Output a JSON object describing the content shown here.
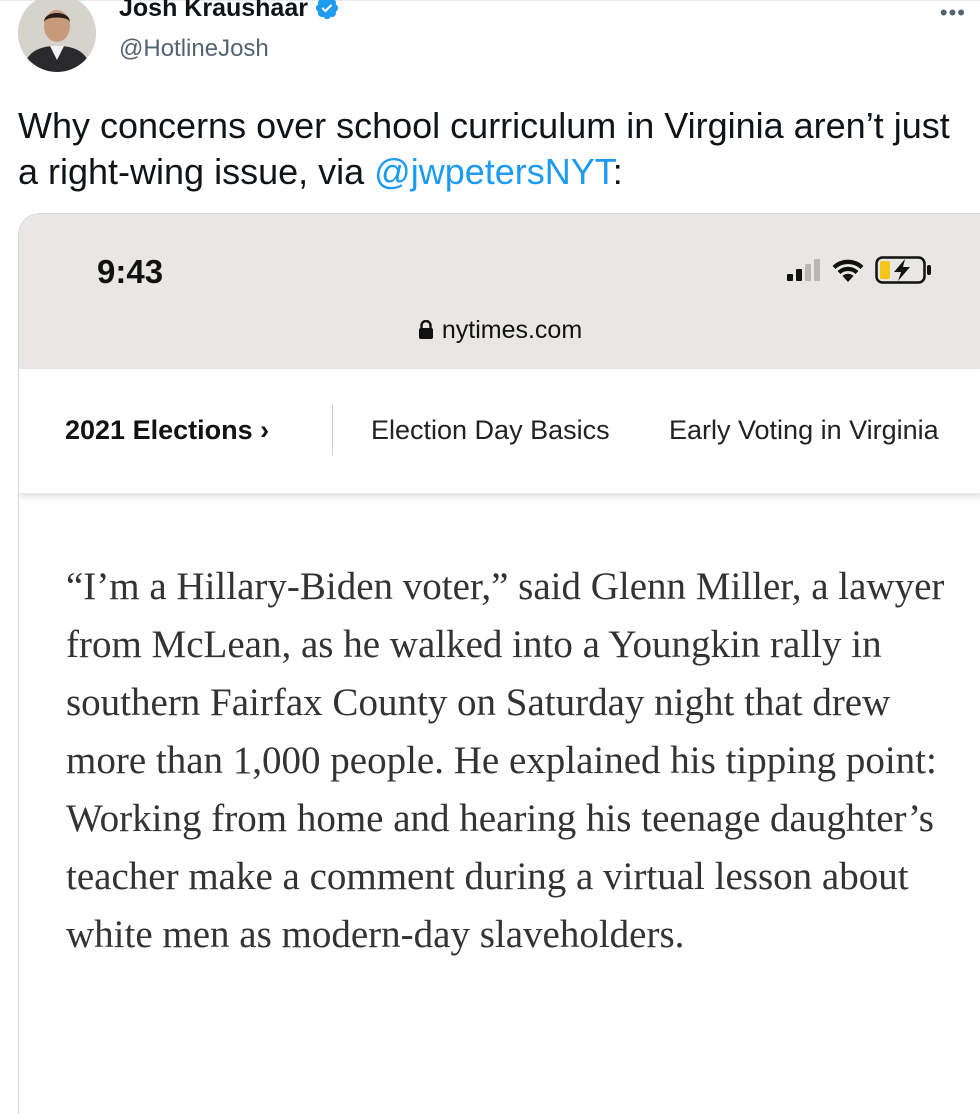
{
  "tweet": {
    "author_name": "Josh Kraushaar",
    "author_handle": "@HotlineJosh",
    "verified": true,
    "more_icon": "more-horizontal-icon",
    "text_before": "Why concerns over school curriculum in Virginia aren’t just a right-wing issue, via ",
    "mention": "@jwpetersNYT",
    "text_after": ":"
  },
  "screenshot": {
    "status_bar": {
      "time": "9:43",
      "icons": [
        "cellular-signal-icon",
        "wifi-icon",
        "battery-charging-icon"
      ]
    },
    "browser": {
      "lock_icon": "lock-icon",
      "url": "nytimes.com"
    },
    "nav": {
      "section_label": "2021 Elections",
      "section_chevron": "›",
      "items": [
        "Election Day Basics",
        "Early Voting in Virginia"
      ]
    },
    "article": {
      "paragraph": "“I’m a Hillary-Biden voter,” said Glenn Miller, a lawyer from McLean, as he walked into a Youngkin rally in southern Fairfax County on Saturday night that drew more than 1,000 people. He explained his tipping point: Working from home and hearing his teenage daughter’s teacher make a comment during a virtual lesson about white men as modern-day slaveholders."
    }
  },
  "colors": {
    "link": "#1d9bf0",
    "verified_badge": "#1d9bf0",
    "secondary_text": "#536471",
    "chrome_bg": "#e9e7e4",
    "battery_charge": "#f5c518"
  }
}
